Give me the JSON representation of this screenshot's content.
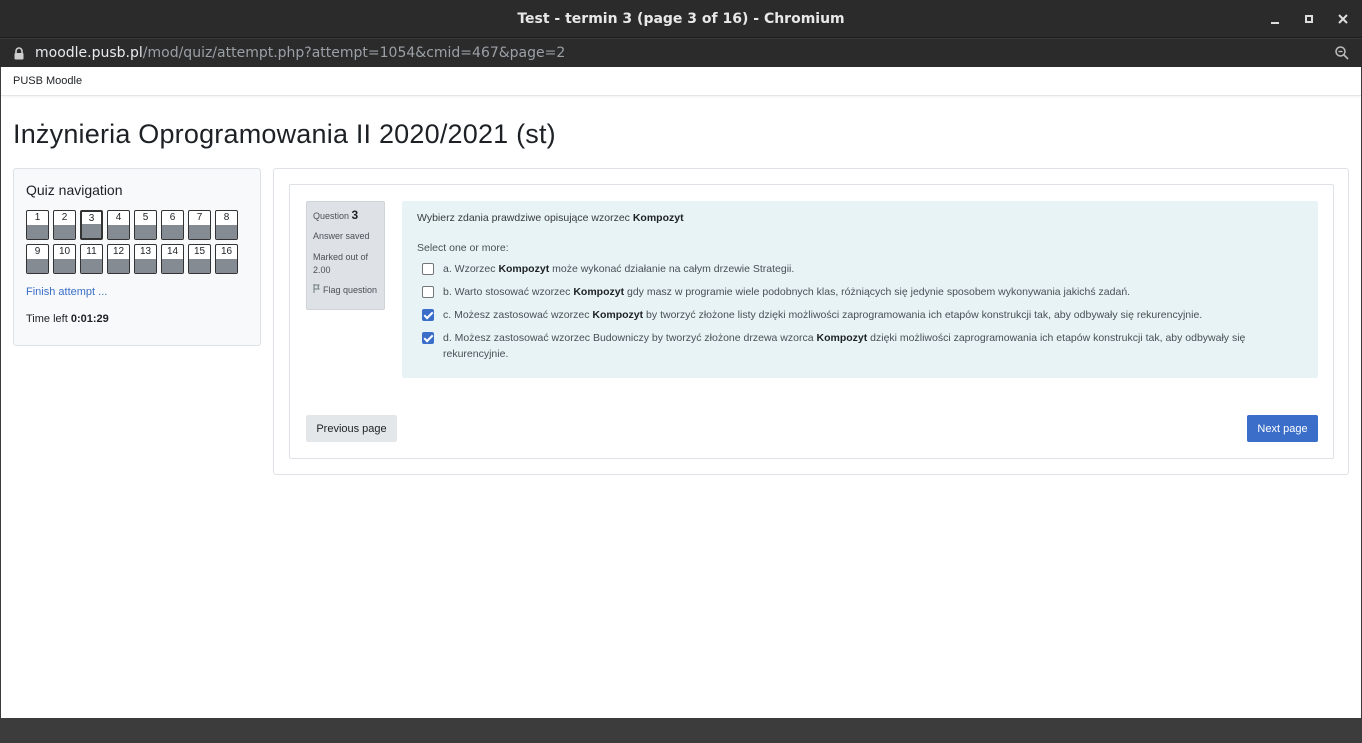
{
  "window": {
    "title": "Test - termin 3 (page 3 of 16) - Chromium"
  },
  "address": {
    "host": "moodle.pusb.pl",
    "path": "/mod/quiz/attempt.php?attempt=1054&cmid=467&page=2"
  },
  "navbar": {
    "brand": "PUSB Moodle"
  },
  "course": {
    "title": "Inżynieria Oprogramowania II 2020/2021 (st)"
  },
  "quiz_nav": {
    "heading": "Quiz navigation",
    "buttons": [
      "1",
      "2",
      "3",
      "4",
      "5",
      "6",
      "7",
      "8",
      "9",
      "10",
      "11",
      "12",
      "13",
      "14",
      "15",
      "16"
    ],
    "current": "3",
    "finish_label": "Finish attempt ...",
    "time_label": "Time left",
    "time_value": "0:01:29"
  },
  "question": {
    "label": "Question",
    "number": "3",
    "state": "Answer saved",
    "marked": "Marked out of 2.00",
    "flag_label": "Flag question",
    "text_prefix": "Wybierz zdania prawdziwe opisujące wzorzec",
    "text_bold": "Kompozyt",
    "prompt": "Select one or more:",
    "options": [
      {
        "pre": "a. Wzorzec ",
        "bold": "Kompozyt",
        "post": " może wykonać działanie na całym drzewie Strategii.",
        "checked": false
      },
      {
        "pre": "b. Warto stosować wzorzec ",
        "bold": "Kompozyt",
        "post": " gdy masz w programie wiele podobnych klas, różniących się jedynie sposobem wykonywania jakichś zadań.",
        "checked": false
      },
      {
        "pre": "c. Możesz zastosować wzorzec ",
        "bold": "Kompozyt",
        "post": " by tworzyć złożone listy dzięki możliwości zaprogramowania ich etapów konstrukcji tak, aby odbywały się rekurencyjnie.",
        "checked": true
      },
      {
        "pre": "d. Możesz zastosować wzorzec Budowniczy by tworzyć złożone drzewa wzorca ",
        "bold": "Kompozyt",
        "post": " dzięki możliwości zaprogramowania ich etapów konstrukcji tak, aby odbywały się rekurencyjnie.",
        "checked": true
      }
    ]
  },
  "buttons": {
    "previous": "Previous page",
    "next": "Next page"
  },
  "colors": {
    "accent": "#3a6ec9",
    "question_bg": "#e7f3f5",
    "chrome_bg": "#2b2b2b"
  }
}
